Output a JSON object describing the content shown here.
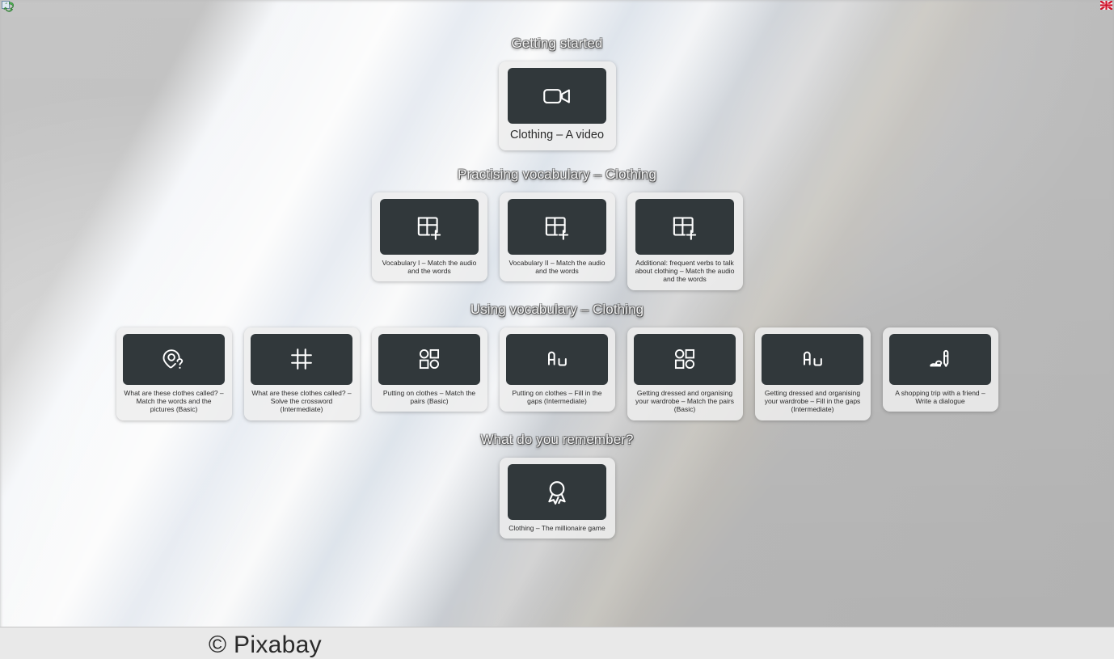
{
  "page": {
    "background_description": "blurred photograph of stacked white books and papers",
    "footer_credit": "© Pixabay",
    "accent_thumb_color": "#31383b",
    "card_bg_color": "#eeeeee",
    "title_color": "#f2f2f2"
  },
  "corner_icons": {
    "left": "recycle-icon",
    "right": "uk-flag-icon"
  },
  "sections": [
    {
      "id": "getting-started",
      "title": "Getting started",
      "cards": [
        {
          "icon": "video-camera-icon",
          "label": "Clothing – A video"
        }
      ]
    },
    {
      "id": "practising-vocabulary",
      "title": "Practising vocabulary – Clothing",
      "cards": [
        {
          "icon": "table-plus-icon",
          "label": "Vocabulary I – Match the audio and the words"
        },
        {
          "icon": "table-plus-icon",
          "label": "Vocabulary II – Match the audio and the words"
        },
        {
          "icon": "table-plus-icon",
          "label": "Additional: frequent verbs to talk about clothing – Match the audio and the words"
        }
      ]
    },
    {
      "id": "using-vocabulary",
      "title": "Using vocabulary – Clothing",
      "cards": [
        {
          "icon": "pin-question-icon",
          "label": "What are these clothes called? – Match the words and the pictures (Basic)"
        },
        {
          "icon": "crossword-icon",
          "label": "What are these clothes called? – Solve the crossword (Intermediate)"
        },
        {
          "icon": "match-pairs-icon",
          "label": "Putting on clothes – Match the pairs (Basic)"
        },
        {
          "icon": "fill-gaps-icon",
          "label": "Putting on clothes – Fill in the gaps (Intermediate)"
        },
        {
          "icon": "match-pairs-icon",
          "label": "Getting dressed and organising your wardrobe – Match the pairs (Basic)"
        },
        {
          "icon": "fill-gaps-icon",
          "label": "Getting dressed and organising your wardrobe – Fill in the gaps (Intermediate)"
        },
        {
          "icon": "pencil-write-icon",
          "label": "A shopping trip with a friend – Write a dialogue"
        }
      ]
    },
    {
      "id": "what-do-you-remember",
      "title": "What do you remember?",
      "cards": [
        {
          "icon": "award-rosette-icon",
          "label": "Clothing – The millionaire game"
        }
      ]
    }
  ]
}
